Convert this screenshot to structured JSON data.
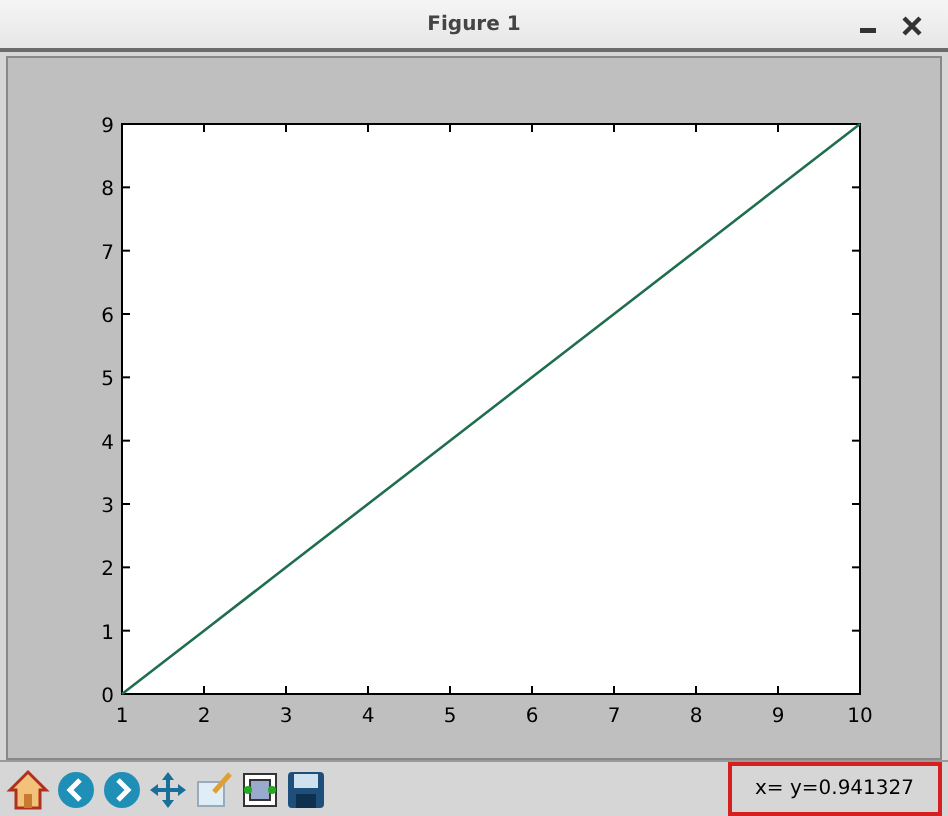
{
  "window": {
    "title": "Figure 1"
  },
  "figure": {
    "chart_data": {
      "type": "line",
      "x": [
        1,
        2,
        3,
        4,
        5,
        6,
        7,
        8,
        9,
        10
      ],
      "series": [
        {
          "color": "#1f6f4f",
          "values": [
            0,
            1,
            2,
            3,
            4,
            5,
            6,
            7,
            8,
            9
          ]
        }
      ],
      "xlim": [
        1,
        10
      ],
      "ylim": [
        0,
        9
      ],
      "xticks": [
        1,
        2,
        3,
        4,
        5,
        6,
        7,
        8,
        9,
        10
      ],
      "yticks": [
        0,
        1,
        2,
        3,
        4,
        5,
        6,
        7,
        8,
        9
      ]
    }
  },
  "toolbar": {
    "status": "x= y=0.941327"
  }
}
